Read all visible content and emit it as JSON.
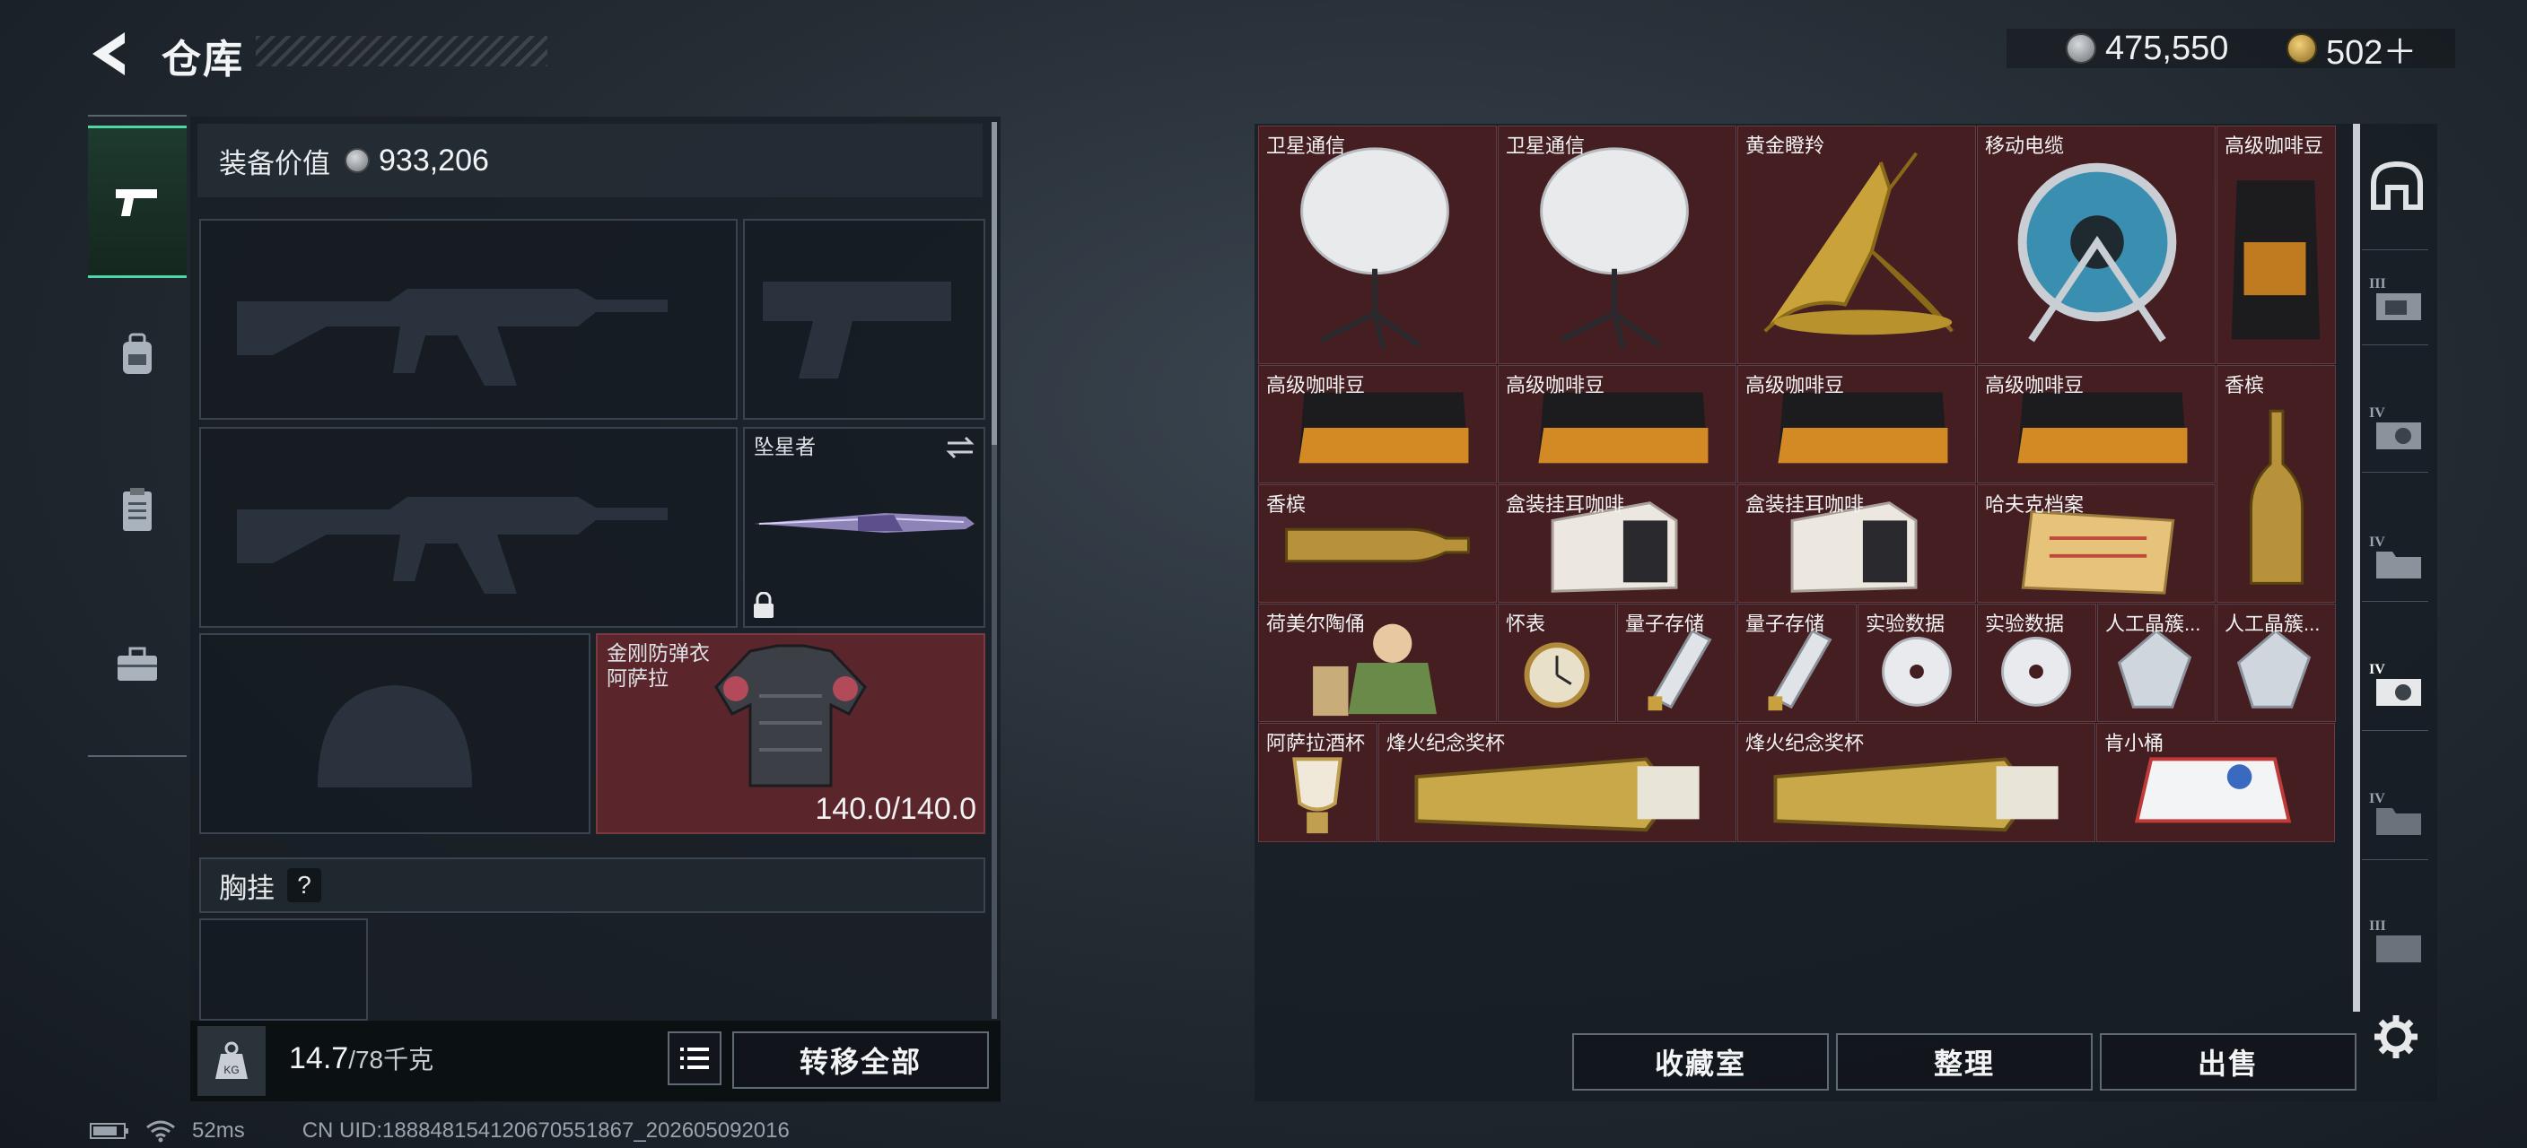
{
  "header": {
    "title": "仓库",
    "currency_1": "475,550",
    "currency_2": "502＋"
  },
  "left_nav": [
    {
      "icon": "pistol-icon",
      "active": true
    },
    {
      "icon": "backpack-icon",
      "active": false
    },
    {
      "icon": "clipboard-icon",
      "active": false
    },
    {
      "icon": "toolbox-icon",
      "active": false
    }
  ],
  "loadout": {
    "equipment_value_label": "装备价值",
    "equipment_value": "933,206",
    "melee_name": "坠星者",
    "armor_name_1": "金刚防弹衣",
    "armor_name_2": "阿萨拉",
    "armor_durability": "140.0/140.0",
    "chest_rig_label": "胸挂",
    "chest_rig_help": "?"
  },
  "weight": {
    "current": "14.7",
    "max": "/78千克"
  },
  "buttons": {
    "transfer_all": "转移全部",
    "collection": "收藏室",
    "sort": "整理",
    "sell": "出售"
  },
  "stash_items": [
    {
      "name": "卫星通信"
    },
    {
      "name": "卫星通信"
    },
    {
      "name": "黄金瞪羚"
    },
    {
      "name": "移动电缆"
    },
    {
      "name": "高级咖啡豆"
    },
    {
      "name": "高级咖啡豆"
    },
    {
      "name": "高级咖啡豆"
    },
    {
      "name": "高级咖啡豆"
    },
    {
      "name": "高级咖啡豆"
    },
    {
      "name": "香槟"
    },
    {
      "name": "香槟"
    },
    {
      "name": "盒装挂耳咖啡"
    },
    {
      "name": "盒装挂耳咖啡"
    },
    {
      "name": "哈夫克档案"
    },
    {
      "name": "荷美尔陶俑"
    },
    {
      "name": "怀表"
    },
    {
      "name": "量子存储"
    },
    {
      "name": "量子存储"
    },
    {
      "name": "实验数据"
    },
    {
      "name": "实验数据"
    },
    {
      "name": "人工晶簇..."
    },
    {
      "name": "人工晶簇..."
    },
    {
      "name": "阿萨拉酒杯"
    },
    {
      "name": "烽火纪念奖杯"
    },
    {
      "name": "烽火纪念奖杯"
    },
    {
      "name": "肯小桶"
    }
  ],
  "right_nav": [
    {
      "icon": "helmet-icon",
      "tier": ""
    },
    {
      "icon": "tier-3-tab-icon",
      "tier": "III"
    },
    {
      "icon": "tier-4-tab-icon",
      "tier": "IV"
    },
    {
      "icon": "tier-4-folder-icon",
      "tier": "IV"
    },
    {
      "icon": "tier-4-tab-active-icon",
      "tier": "IV"
    },
    {
      "icon": "tier-4-folder-2-icon",
      "tier": "IV"
    },
    {
      "icon": "tier-3-folder-icon",
      "tier": "III"
    }
  ],
  "status": {
    "ping": "52ms",
    "uid": "CN UID:18884815412067055186​7_202605092016"
  },
  "colors": {
    "accent": "#4fd6a5",
    "stash_cell": "#451e22",
    "armor_slot": "#5a262c",
    "gold_coin": "#c8a24a"
  }
}
